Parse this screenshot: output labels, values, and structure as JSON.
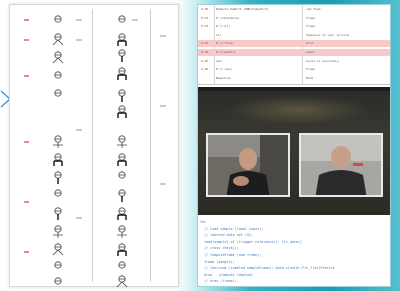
{
  "table": {
    "rows": [
      {
        "id": "0.00",
        "name": "Roberts DeWitt (OWD/Comwatch)",
        "value": "cam Feed"
      },
      {
        "id": "0.01",
        "name": "P'(reference)",
        "value": "Frame"
      },
      {
        "id": "0.02",
        "name": "P'(r(t))",
        "value": "Frame"
      },
      {
        "id": "",
        "name": "Ltr",
        "value": "Sequence of user actions"
      },
      {
        "id": "0.03",
        "name": "P'(r-flip)",
        "value": "Grid"
      },
      {
        "id": "0.04",
        "name": "P'(r(edit))",
        "value": "Label"
      },
      {
        "id": "0.05",
        "name": "sat",
        "value": "Scale is available"
      },
      {
        "id": "0.06",
        "name": "P'(r-vec)",
        "value": "Frame"
      },
      {
        "id": "",
        "name": "Baseline",
        "value": "Node"
      }
    ]
  },
  "code": {
    "lines": [
      "for",
      "  // Load sample (label input);",
      "  // labeled data set (0);",
      "  load(sample) of (trigger reference)); fit_data()",
      "  // cross check();",
      "  // ComputeFrame (new frame);",
      "  frame (sample);",
      "  // Conclude (Labeled sampleFrame); data-cluster.Fit_flat(Prefire",
      "  draw   (Compute labeled)",
      "  // draw (frame);"
    ]
  }
}
